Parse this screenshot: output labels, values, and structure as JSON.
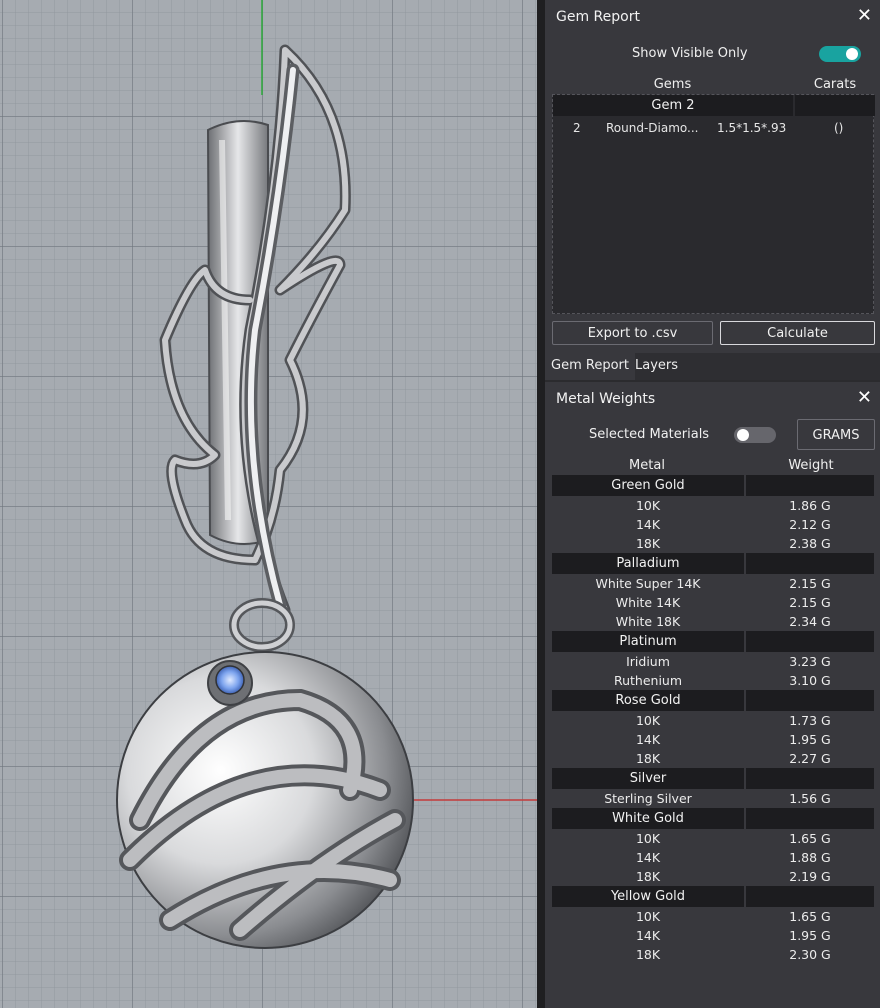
{
  "gem_report": {
    "title": "Gem Report",
    "show_visible_label": "Show Visible Only",
    "show_visible_on": true,
    "columns": {
      "gems": "Gems",
      "carats": "Carats"
    },
    "group": "Gem 2",
    "gem_row": {
      "count": "2",
      "name": "Round-Diamo...",
      "size": "1.5*1.5*.93",
      "carats": "()"
    },
    "export_label": "Export to .csv",
    "calculate_label": "Calculate"
  },
  "tabs": [
    "Gem Report",
    "Layers"
  ],
  "metal_weights": {
    "title": "Metal Weights",
    "selected_label": "Selected Materials",
    "selected_on": false,
    "units_label": "GRAMS",
    "columns": {
      "metal": "Metal",
      "weight": "Weight"
    },
    "groups": [
      {
        "name": "Green Gold",
        "rows": [
          [
            "10K",
            "1.86 G"
          ],
          [
            "14K",
            "2.12 G"
          ],
          [
            "18K",
            "2.38 G"
          ]
        ]
      },
      {
        "name": "Palladium",
        "rows": [
          [
            "White Super 14K",
            "2.15 G"
          ],
          [
            "White 14K",
            "2.15 G"
          ],
          [
            "White 18K",
            "2.34 G"
          ]
        ]
      },
      {
        "name": "Platinum",
        "rows": [
          [
            "Iridium",
            "3.23 G"
          ],
          [
            "Ruthenium",
            "3.10 G"
          ]
        ]
      },
      {
        "name": "Rose Gold",
        "rows": [
          [
            "10K",
            "1.73 G"
          ],
          [
            "14K",
            "1.95 G"
          ],
          [
            "18K",
            "2.27 G"
          ]
        ]
      },
      {
        "name": "Silver",
        "rows": [
          [
            "Sterling Silver",
            "1.56 G"
          ]
        ]
      },
      {
        "name": "White Gold",
        "rows": [
          [
            "10K",
            "1.65 G"
          ],
          [
            "14K",
            "1.88 G"
          ],
          [
            "18K",
            "2.19 G"
          ]
        ]
      },
      {
        "name": "Yellow Gold",
        "rows": [
          [
            "10K",
            "1.65 G"
          ],
          [
            "14K",
            "1.95 G"
          ],
          [
            "18K",
            "2.30 G"
          ]
        ]
      }
    ]
  },
  "colors": {
    "accent": "#19a3a0",
    "panel": "#38383d",
    "viewport": "#a6abb1"
  },
  "icons": {
    "close": "close-icon"
  }
}
